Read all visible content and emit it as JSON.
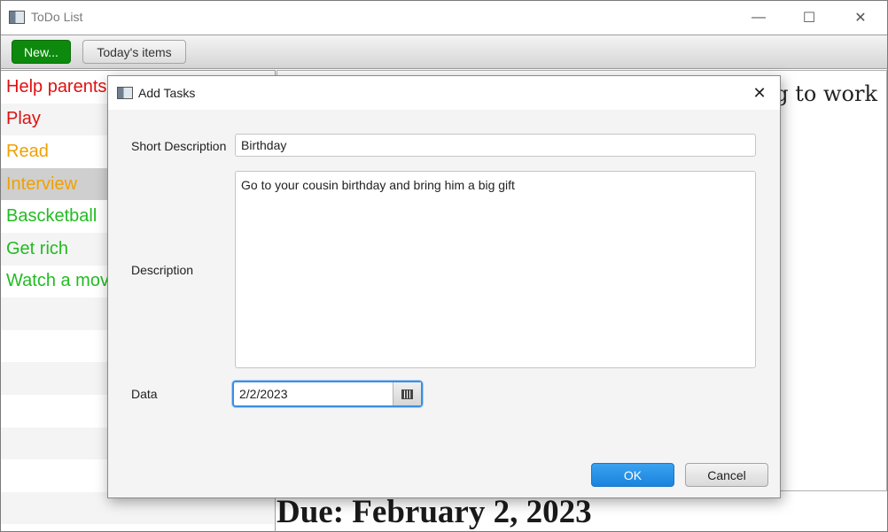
{
  "window": {
    "title": "ToDo List",
    "minimize": "—",
    "maximize": "☐",
    "close": "✕"
  },
  "toolbar": {
    "new_label": "New...",
    "today_label": "Today's items"
  },
  "list": {
    "items": [
      {
        "label": "Help parents",
        "color": "#e01010"
      },
      {
        "label": "Play",
        "color": "#e01010"
      },
      {
        "label": "Read",
        "color": "#f0a000"
      },
      {
        "label": "Interview",
        "color": "#f0a000"
      },
      {
        "label": "Bascketball",
        "color": "#22bb22"
      },
      {
        "label": "Get rich",
        "color": "#22bb22"
      },
      {
        "label": "Watch a mov",
        "color": "#22bb22"
      }
    ],
    "selected_index": 3
  },
  "detail": {
    "text": "g to work",
    "due": "Due: February 2, 2023"
  },
  "dialog": {
    "title": "Add Tasks",
    "close": "✕",
    "short_description_label": "Short Description",
    "short_description_value": "Birthday",
    "description_label": "Description",
    "description_value": "Go to your cousin birthday and bring him a big gift",
    "date_label": "Data",
    "date_value": "2/2/2023",
    "ok_label": "OK",
    "cancel_label": "Cancel"
  }
}
